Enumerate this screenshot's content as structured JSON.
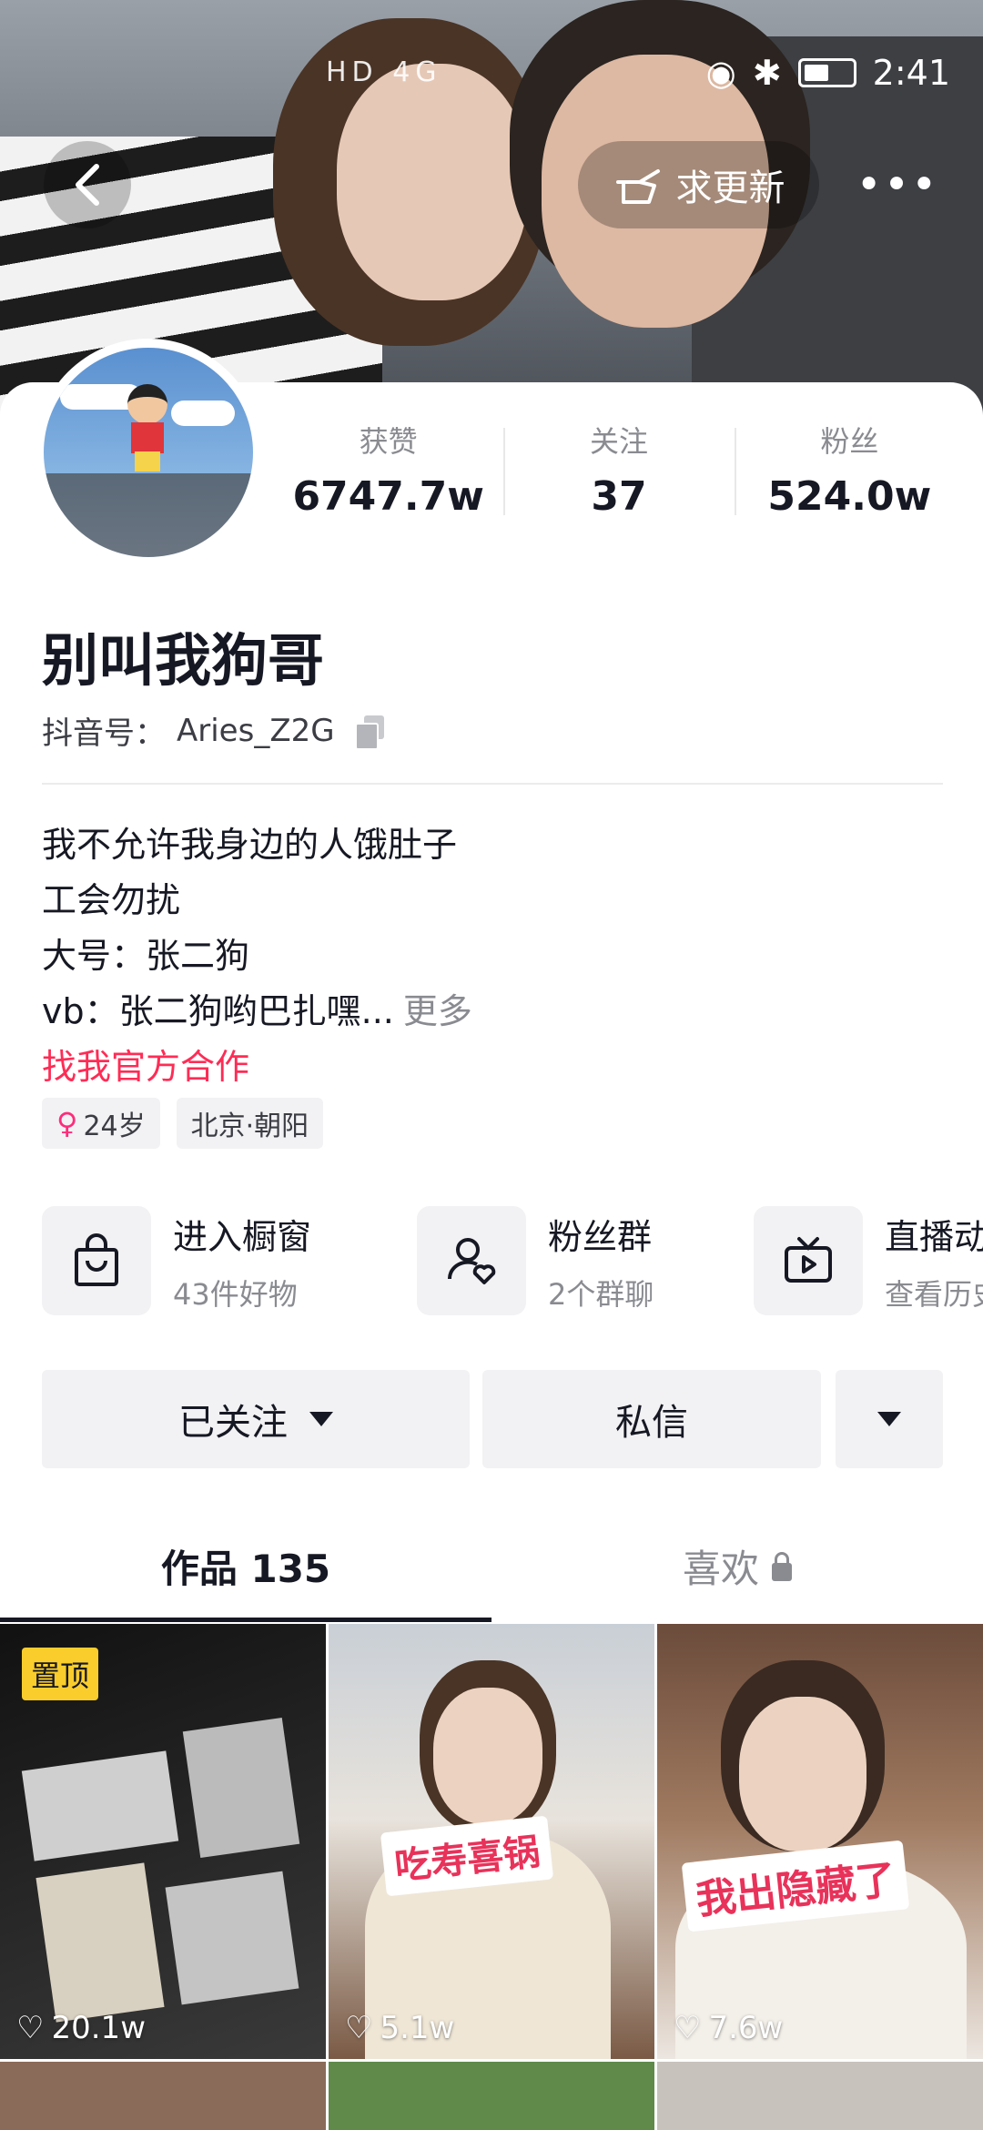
{
  "status_bar": {
    "network_indicators": "HD 4G",
    "time": "2:41"
  },
  "header": {
    "request_update_label": "求更新",
    "more_label": "•••"
  },
  "profile": {
    "stats": [
      {
        "label": "获赞",
        "value": "6747.7w"
      },
      {
        "label": "关注",
        "value": "37"
      },
      {
        "label": "粉丝",
        "value": "524.0w"
      }
    ],
    "name": "别叫我狗哥",
    "douyin_id_label": "抖音号：",
    "douyin_id": "Aries_Z2G",
    "bio_lines": [
      "我不允许我身边的人饿肚子",
      "工会勿扰",
      "大号：张二狗",
      "vb：张二狗哟巴扎嘿..."
    ],
    "bio_more": "更多",
    "collab_link": "找我官方合作",
    "tags": [
      {
        "icon": "female-icon",
        "text": "24岁"
      },
      {
        "text": "北京·朝阳"
      }
    ]
  },
  "entries": [
    {
      "icon": "shopping-bag-icon",
      "title": "进入橱窗",
      "subtitle": "43件好物"
    },
    {
      "icon": "fan-group-icon",
      "title": "粉丝群",
      "subtitle": "2个群聊"
    },
    {
      "icon": "tv-play-icon",
      "title": "直播动态",
      "subtitle": "查看历史"
    }
  ],
  "actions": {
    "followed_label": "已关注",
    "message_label": "私信"
  },
  "tabs": {
    "works_label": "作品 135",
    "likes_label": "喜欢"
  },
  "videos": [
    {
      "pinned_label": "置顶",
      "likes": "20.1w"
    },
    {
      "overlay": "吃寿喜锅",
      "likes": "5.1w"
    },
    {
      "overlay": "我出隐藏了",
      "likes": "7.6w"
    }
  ],
  "colors": {
    "accent_red": "#fe2c55",
    "pin_yellow": "#facd2c",
    "text_primary": "#161823",
    "text_secondary": "#8a8b91"
  }
}
